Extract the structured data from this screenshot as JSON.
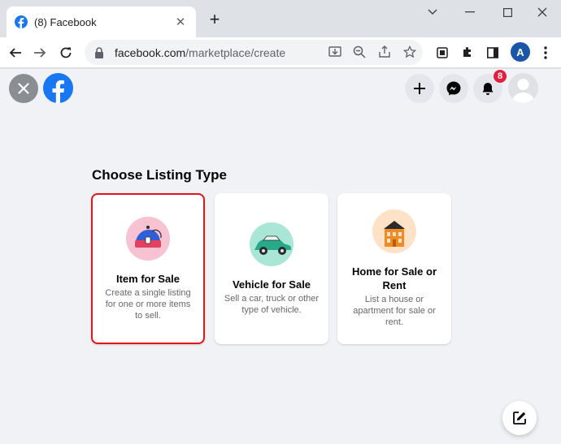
{
  "browser": {
    "tab_title": "(8) Facebook",
    "tab_close": "✕",
    "new_tab": "+",
    "url_host": "facebook.com",
    "url_path": "/marketplace/create",
    "profile_initial": "A"
  },
  "header": {
    "notification_count": "8"
  },
  "main": {
    "heading": "Choose Listing Type",
    "cards": [
      {
        "title": "Item for Sale",
        "description": "Create a single listing for one or more items to sell.",
        "selected": true
      },
      {
        "title": "Vehicle for Sale",
        "description": "Sell a car, truck or other type of vehicle.",
        "selected": false
      },
      {
        "title": "Home for Sale or Rent",
        "description": "List a house or apartment for sale or rent.",
        "selected": false
      }
    ]
  },
  "colors": {
    "brand": "#1877f2",
    "selected_border": "#e4141b",
    "badge": "#e41e3f",
    "page_bg": "#f0f2f5"
  },
  "icons": {
    "favicon": "facebook-icon",
    "close": "close-icon",
    "create": "plus-icon",
    "messenger": "messenger-icon",
    "notifications": "bell-icon",
    "compose": "compose-icon"
  }
}
